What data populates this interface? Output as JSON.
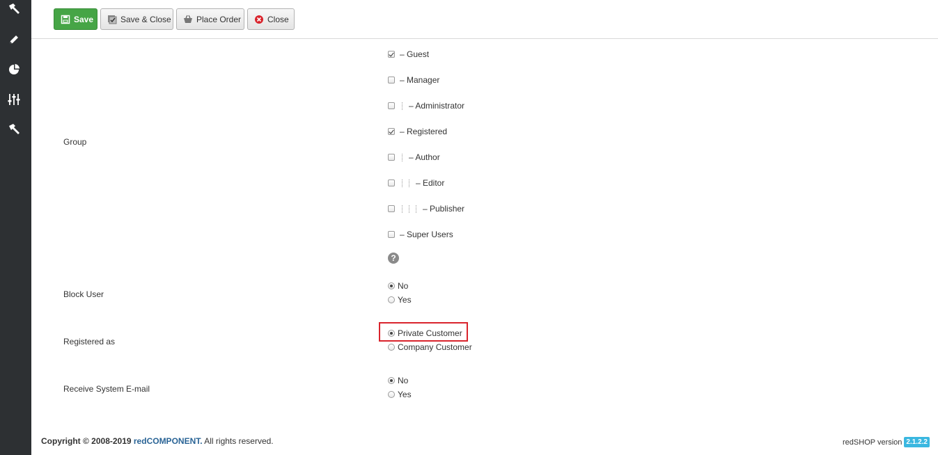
{
  "sidebar": {
    "icons": [
      "hammer-icon",
      "pencil-icon",
      "pie-chart-icon",
      "sliders-icon",
      "hammer-icon"
    ]
  },
  "toolbar": {
    "save_label": "Save",
    "save_close_label": "Save & Close",
    "place_order_label": "Place Order",
    "close_label": "Close",
    "save_color": "#46a546",
    "close_icon_color": "#d9242c"
  },
  "form": {
    "group": {
      "label": "Group",
      "items": [
        {
          "label": "– Guest",
          "checked": true,
          "depth": 0
        },
        {
          "label": "– Manager",
          "checked": false,
          "depth": 0
        },
        {
          "label": "– Administrator",
          "checked": false,
          "depth": 1
        },
        {
          "label": "– Registered",
          "checked": true,
          "depth": 0
        },
        {
          "label": "– Author",
          "checked": false,
          "depth": 1
        },
        {
          "label": "– Editor",
          "checked": false,
          "depth": 2
        },
        {
          "label": "– Publisher",
          "checked": false,
          "depth": 3
        },
        {
          "label": "– Super Users",
          "checked": false,
          "depth": 0
        }
      ],
      "help_icon": "question-icon"
    },
    "block_user": {
      "label": "Block User",
      "options": [
        "No",
        "Yes"
      ],
      "selected": "No"
    },
    "registered_as": {
      "label": "Registered as",
      "options": [
        "Private Customer",
        "Company Customer"
      ],
      "selected": "Private Customer",
      "highlight_color": "#d9242c"
    },
    "receive_email": {
      "label": "Receive System E-mail",
      "options": [
        "No",
        "Yes"
      ],
      "selected": "No"
    }
  },
  "footer": {
    "copyright_prefix": "Copyright © 2008-2019 ",
    "link_text": "redCOMPONENT",
    "suffix": ". All rights reserved.",
    "version_label": "redSHOP version",
    "version": "2.1.2.2",
    "version_badge_color": "#3ab7e0"
  }
}
